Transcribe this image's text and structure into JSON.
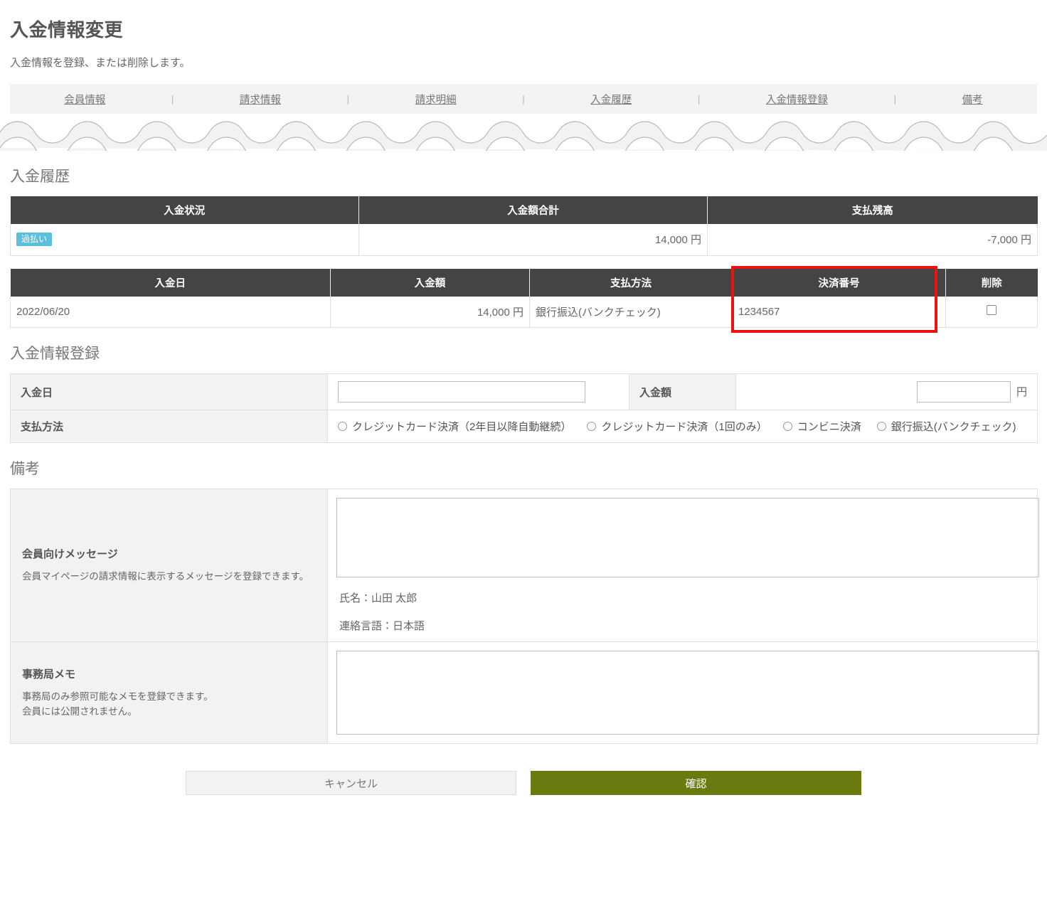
{
  "page": {
    "title": "入金情報変更",
    "description": "入金情報を登録、または削除します。"
  },
  "nav": {
    "separator": "|",
    "items": [
      {
        "label": "会員情報"
      },
      {
        "label": "請求情報"
      },
      {
        "label": "請求明細"
      },
      {
        "label": "入金履歴"
      },
      {
        "label": "入金情報登録"
      },
      {
        "label": "備考"
      }
    ]
  },
  "payment_history": {
    "heading": "入金履歴",
    "summary": {
      "headers": [
        "入金状況",
        "入金額合計",
        "支払残高"
      ],
      "status_badge": "過払い",
      "total_paid": "14,000 円",
      "balance": "-7,000 円",
      "balance_color": "#2b6cb0",
      "badge_color": "#5bc0de"
    },
    "detail": {
      "headers": [
        "入金日",
        "入金額",
        "支払方法",
        "決済番号",
        "削除"
      ],
      "rows": [
        {
          "date": "2022/06/20",
          "amount": "14,000 円",
          "method": "銀行振込(バンクチェック)",
          "payment_no": "1234567",
          "delete_checked": false
        }
      ],
      "highlight_color": "#ee1111"
    }
  },
  "registration": {
    "heading": "入金情報登録",
    "fields": {
      "date_label": "入金日",
      "date_value": "",
      "amount_label": "入金額",
      "amount_value": "",
      "amount_unit": "円",
      "method_label": "支払方法"
    },
    "method_options": [
      {
        "label": "クレジットカード決済（2年目以降自動継続）",
        "selected": false
      },
      {
        "label": "クレジットカード決済（1回のみ）",
        "selected": false
      },
      {
        "label": "コンビニ決済",
        "selected": false
      },
      {
        "label": "銀行振込(バンクチェック)",
        "selected": false
      }
    ]
  },
  "remarks": {
    "heading": "備考",
    "member_message": {
      "title": "会員向けメッセージ",
      "note": "会員マイページの請求情報に表示するメッセージを登録できます。",
      "value": "",
      "info_name": "氏名：山田 太郎",
      "info_language": "連絡言語：日本語"
    },
    "office_memo": {
      "title": "事務局メモ",
      "note_line1": "事務局のみ参照可能なメモを登録できます。",
      "note_line2": "会員には公開されません。",
      "value": ""
    }
  },
  "footer": {
    "cancel_label": "キャンセル",
    "confirm_label": "確認",
    "confirm_color": "#6b7a10"
  }
}
